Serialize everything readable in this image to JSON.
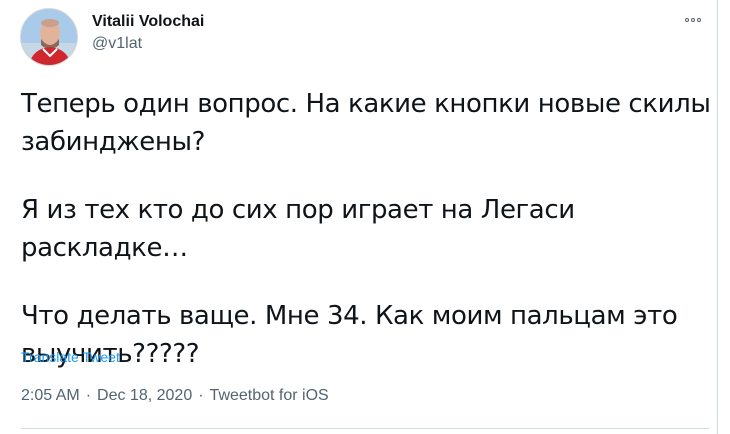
{
  "author": {
    "display_name": "Vitalii Volochai",
    "handle": "@v1lat"
  },
  "tweet": {
    "paragraphs": [
      "Теперь один вопрос. На какие кнопки новые скилы забинджены?",
      "Я из тех кто до сих пор играет на Легаси раскладке…",
      "Что делать ваще. Мне 34. Как моим пальцам это выучить?????"
    ],
    "translate_label": "Translate Tweet"
  },
  "meta": {
    "time": "2:05 AM",
    "separator": "·",
    "date": "Dec 18, 2020",
    "source": "Tweetbot for iOS"
  },
  "icons": {
    "more": "more-horizontal-icon",
    "avatar": "profile-photo"
  },
  "colors": {
    "link": "#1d9bf0",
    "secondary_text": "#536471",
    "primary_text": "#0f1419"
  }
}
